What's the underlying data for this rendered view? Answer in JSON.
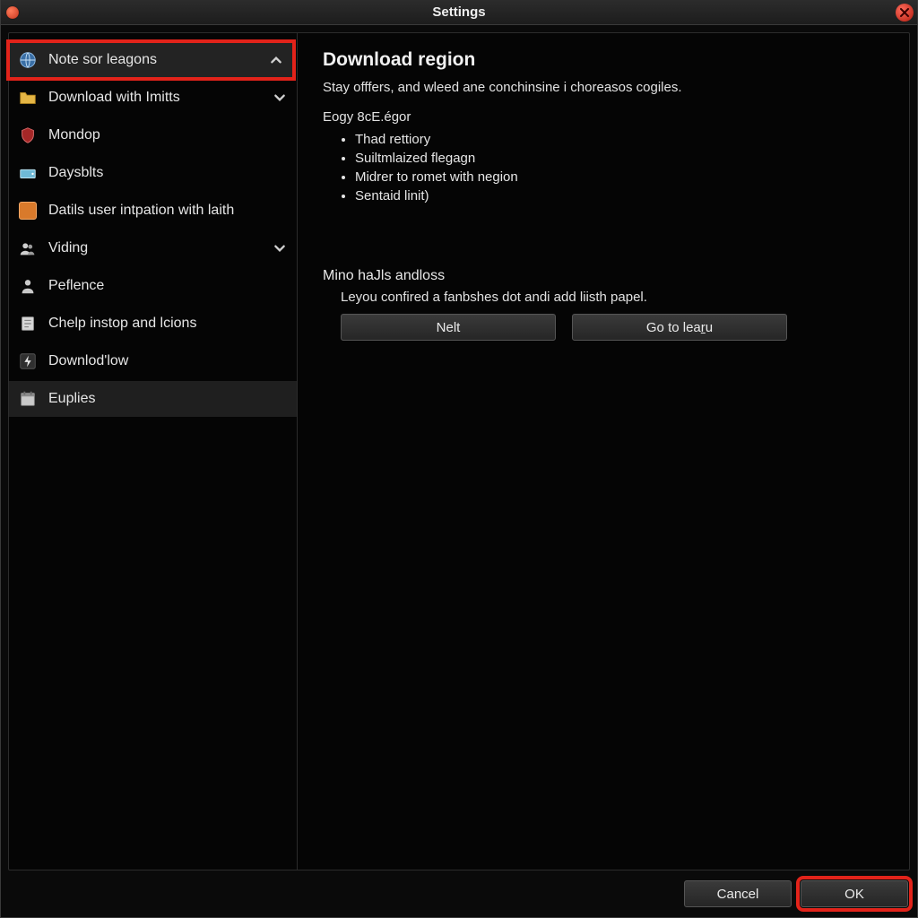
{
  "window": {
    "title": "Settings"
  },
  "sidebar": {
    "items": [
      {
        "label": "Note sor leagons",
        "icon": "globe-icon",
        "chevron": "up",
        "selected": true,
        "highlight": true
      },
      {
        "label": "Download with Imitts",
        "icon": "folder-icon",
        "chevron": "down"
      },
      {
        "label": "Mondop",
        "icon": "shield-icon"
      },
      {
        "label": "Daysblts",
        "icon": "drive-icon"
      },
      {
        "label": "Datils user intpation with laith",
        "icon": "square-icon"
      },
      {
        "label": "Viding",
        "icon": "users-icon",
        "chevron": "down"
      },
      {
        "label": "Peflence",
        "icon": "person-icon"
      },
      {
        "label": "Chelp instop and lcions",
        "icon": "note-icon"
      },
      {
        "label": "Downlod'low",
        "icon": "bolt-icon"
      },
      {
        "label": "Euplies",
        "icon": "calendar-icon",
        "subselected": true
      }
    ]
  },
  "main": {
    "heading": "Download region",
    "description": "Stay offfers, and wleed ane conchinsine i choreasos cogiles.",
    "group_label": "Eogy 8cE.égor",
    "bullets": [
      "Thad rettiory",
      "Suiltmlaized flegagn",
      "Midrer to romet with negion",
      "Sentaid linit)"
    ],
    "section2_title": "Mino haJls andloss",
    "section2_desc": "Leyou confired a fanbshes dot andi add liisth papel.",
    "button_nelt": "Nelt",
    "button_goto_pre": "Go to lea",
    "button_goto_ul": "r",
    "button_goto_post": "u"
  },
  "footer": {
    "cancel": "Cancel",
    "ok": "OK"
  }
}
